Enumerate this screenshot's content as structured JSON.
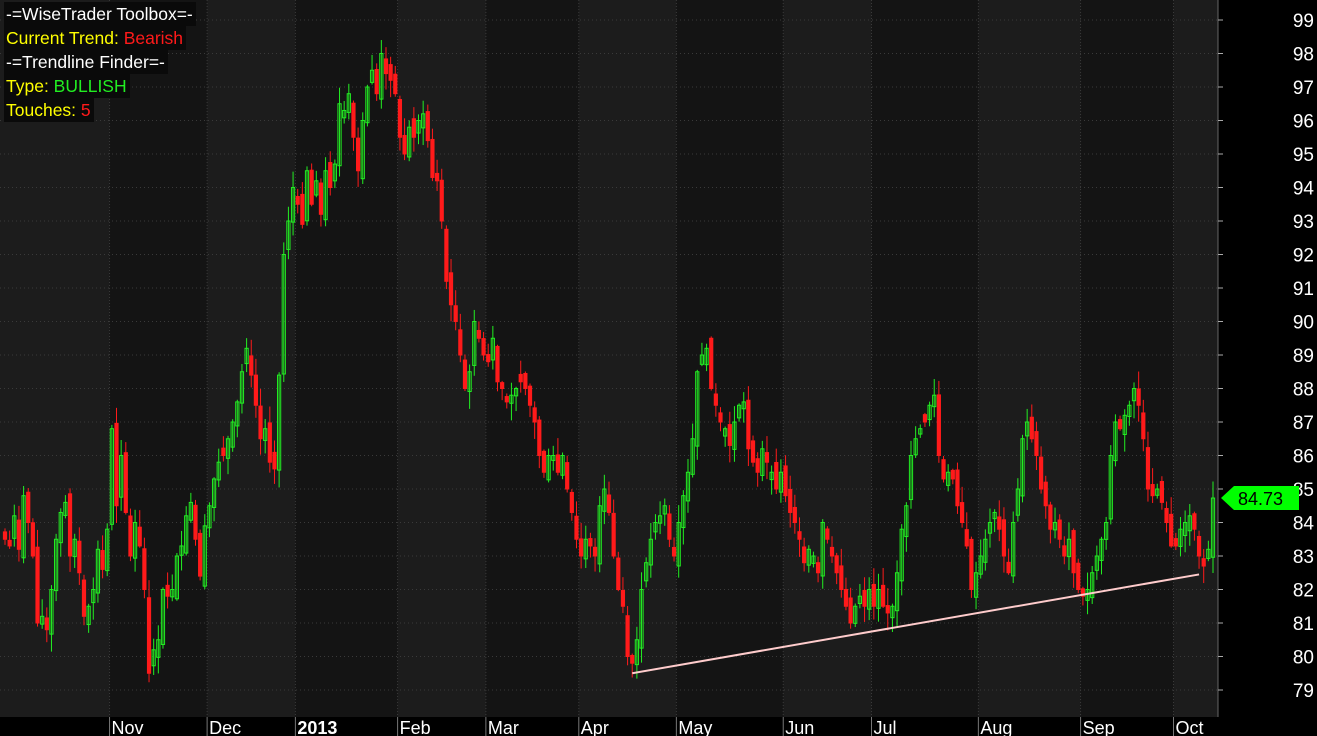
{
  "overlay": {
    "toolbox_title": "-=WiseTrader Toolbox=-",
    "trend_label": "Current Trend: ",
    "trend_value": "Bearish",
    "finder_title": "-=Trendline Finder=-",
    "type_label": "Type: ",
    "type_value": "BULLISH",
    "touches_label": "Touches: ",
    "touches_value": "5"
  },
  "colors": {
    "background": "#000000",
    "plot_background": "#1c1c1c",
    "panel_background": "#141414",
    "grid": "#3a3a3a",
    "up_candle": "#22ee22",
    "down_candle": "#ff1a1a",
    "trendline": "#ffcccc",
    "axis_text": "#ffffff",
    "price_marker": "#00ff00"
  },
  "chart_data": {
    "type": "candlestick",
    "ylim": [
      78.5,
      99.5
    ],
    "y_ticks": [
      79,
      80,
      81,
      82,
      83,
      84,
      85,
      86,
      87,
      88,
      89,
      90,
      91,
      92,
      93,
      94,
      95,
      96,
      97,
      98,
      99
    ],
    "x_ticks": [
      {
        "label": "Nov",
        "month": "2012-11",
        "bar": 23,
        "bold": false
      },
      {
        "label": "Dec",
        "month": "2012-12",
        "bar": 44,
        "bold": false
      },
      {
        "label": "2013",
        "month": "2013-01",
        "bar": 63,
        "bold": true
      },
      {
        "label": "Feb",
        "month": "2013-02",
        "bar": 85,
        "bold": false
      },
      {
        "label": "Mar",
        "month": "2013-03",
        "bar": 104,
        "bold": false
      },
      {
        "label": "Apr",
        "month": "2013-04",
        "bar": 124,
        "bold": false
      },
      {
        "label": "May",
        "month": "2013-05",
        "bar": 145,
        "bold": false
      },
      {
        "label": "Jun",
        "month": "2013-06",
        "bar": 168,
        "bold": false
      },
      {
        "label": "Jul",
        "month": "2013-07",
        "bar": 187,
        "bold": false
      },
      {
        "label": "Aug",
        "month": "2013-08",
        "bar": 210,
        "bold": false
      },
      {
        "label": "Sep",
        "month": "2013-09",
        "bar": 232,
        "bold": false
      },
      {
        "label": "Oct",
        "month": "2013-10",
        "bar": 252,
        "bold": false
      }
    ],
    "last_price": "84.73",
    "last_price_value": 84.73,
    "trendline": {
      "start_bar": 135,
      "start_price": 79.5,
      "end_bar": 257,
      "end_price": 82.45,
      "touches": 5
    },
    "closes": [
      83.5,
      83.3,
      84.2,
      83.2,
      84.8,
      84.0,
      83.0,
      81.0,
      81.2,
      80.8,
      82.0,
      83.5,
      84.3,
      84.6,
      83.0,
      83.5,
      82.5,
      81.2,
      81.5,
      82.0,
      83.2,
      82.6,
      83.8,
      86.8,
      84.5,
      86.0,
      84.3,
      83.0,
      84.0,
      83.3,
      82.0,
      79.5,
      80.2,
      80.5,
      82.0,
      81.8,
      82.0,
      83.0,
      83.3,
      84.2,
      84.6,
      83.5,
      82.4,
      83.9,
      84.5,
      85.3,
      85.8,
      86.0,
      86.5,
      87.0,
      87.6,
      88.5,
      89.2,
      88.4,
      87.5,
      86.5,
      86.8,
      85.8,
      85.6,
      88.4,
      92.0,
      93.0,
      94.0,
      93.5,
      92.9,
      94.5,
      93.5,
      94.2,
      93.2,
      94.5,
      94.0,
      94.7,
      96.5,
      96.3,
      96.8,
      95.5,
      94.5,
      96.0,
      97.0,
      97.5,
      96.8,
      98.0,
      97.4,
      97.2,
      96.8,
      95.5,
      95.0,
      95.8,
      95.5,
      96.0,
      96.2,
      95.4,
      94.3,
      94.2,
      93.0,
      91.2,
      90.5,
      90.0,
      89.0,
      88.0,
      88.5,
      90.0,
      89.5,
      89.0,
      88.8,
      89.5,
      88.2,
      88.0,
      87.6,
      87.8,
      88.0,
      88.2,
      88.0,
      87.5,
      87.0,
      86.0,
      85.5,
      86.0,
      86.0,
      85.5,
      86.0,
      85.0,
      84.3,
      83.5,
      83.0,
      83.5,
      83.3,
      83.0,
      84.5,
      85.0,
      84.3,
      83.0,
      82.0,
      81.5,
      80.0,
      79.8,
      80.5,
      82.0,
      82.8,
      83.5,
      84.0,
      84.2,
      84.5,
      83.5,
      83.0,
      84.0,
      84.8,
      85.5,
      86.5,
      88.5,
      89.0,
      89.2,
      88.0,
      87.5,
      87.0,
      86.8,
      86.3,
      87.0,
      87.5,
      87.6,
      86.2,
      85.8,
      85.5,
      86.2,
      85.8,
      85.5,
      85.0,
      85.5,
      84.8,
      84.3,
      84.0,
      83.5,
      82.8,
      83.2,
      83.0,
      82.5,
      84.0,
      83.5,
      83.0,
      82.5,
      82.0,
      81.5,
      81.0,
      81.5,
      81.8,
      81.5,
      82.0,
      81.5,
      82.0,
      81.5,
      81.3,
      81.5,
      82.5,
      83.8,
      84.5,
      86.0,
      86.5,
      86.8,
      87.0,
      87.5,
      87.8,
      86.0,
      85.3,
      85.5,
      85.3,
      84.5,
      84.0,
      83.3,
      82.0,
      82.5,
      83.0,
      83.5,
      84.0,
      84.3,
      83.8,
      83.0,
      82.5,
      84.0,
      85.0,
      86.5,
      87.0,
      86.5,
      86.0,
      85.0,
      84.5,
      83.8,
      84.0,
      83.5,
      83.0,
      83.5,
      82.5,
      82.0,
      81.8,
      82.0,
      82.5,
      83.0,
      83.5,
      84.0,
      86.0,
      87.0,
      86.8,
      87.2,
      87.5,
      88.0,
      87.5,
      86.5,
      85.0,
      84.8,
      85.0,
      84.6,
      84.0,
      83.3,
      83.3,
      83.8,
      84.0,
      84.2,
      83.8,
      83.0,
      82.7,
      83.2,
      84.73
    ],
    "volatility": 0.6
  }
}
